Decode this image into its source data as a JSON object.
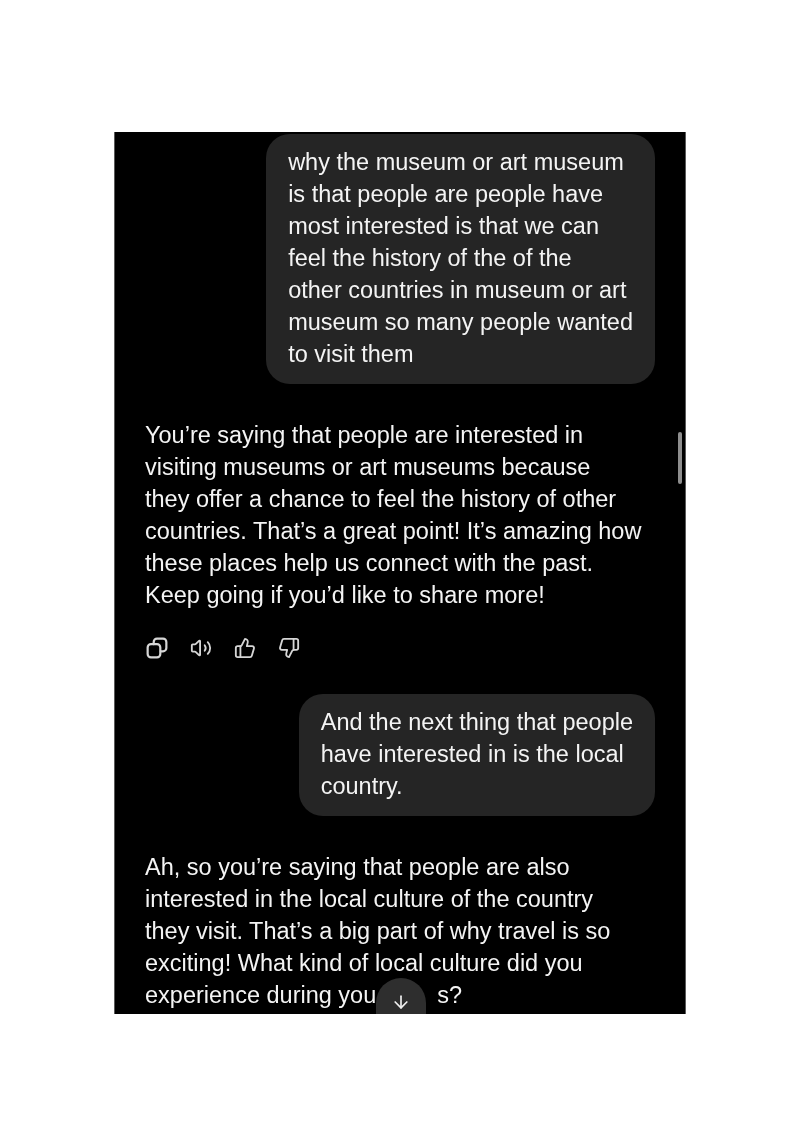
{
  "chat": {
    "messages": [
      {
        "kind": "user",
        "lines": [
          "why the museum or art museum",
          "is that people are people have",
          "most interested is that we can",
          "feel the history of the of the",
          "other countries in museum or art",
          "museum so many people wanted",
          "to visit them"
        ]
      },
      {
        "kind": "assistant",
        "lines": [
          "You’re saying that people are interested in",
          "visiting museums or art museums because",
          "they offer a chance to feel the history of other",
          "countries. That’s a great point! It’s amazing how",
          "these places help us connect with the past.",
          "Keep going if you’d like to share more!"
        ],
        "actions": true
      },
      {
        "kind": "user",
        "lines": [
          "And the next thing that people",
          "have interested in is the local",
          "country."
        ]
      },
      {
        "kind": "assistant",
        "lines": [
          "Ah, so you’re saying that people are also",
          "interested in the local culture of the country",
          "they visit. That’s a big part of why travel is so",
          "exciting! What kind of local culture did you"
        ],
        "last_line": "experience during you",
        "after_scroll_button": "s?"
      }
    ]
  }
}
